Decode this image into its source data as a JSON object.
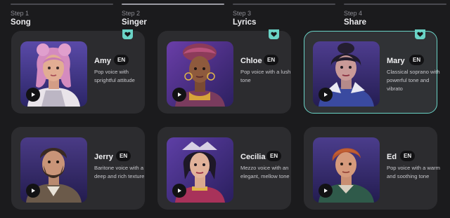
{
  "steps": [
    {
      "number": "Step 1",
      "name": "Song"
    },
    {
      "number": "Step 2",
      "name": "Singer"
    },
    {
      "number": "Step 3",
      "name": "Lyrics"
    },
    {
      "number": "Step 4",
      "name": "Share"
    }
  ],
  "active_step": "Step 2",
  "accent_color": "#6ad3c6",
  "singers": [
    {
      "name": "Amy",
      "lang": "EN",
      "desc": "Pop voice with sprightful attitude",
      "favorite": true,
      "selected": false
    },
    {
      "name": "Chloe",
      "lang": "EN",
      "desc": "Pop voice with a lush tone",
      "favorite": true,
      "selected": false
    },
    {
      "name": "Mary",
      "lang": "EN",
      "desc": "Classical soprano with powerful tone and vibrato",
      "favorite": true,
      "selected": true
    },
    {
      "name": "Jerry",
      "lang": "EN",
      "desc": "Baritone voice with a deep and rich texture",
      "favorite": false,
      "selected": false
    },
    {
      "name": "Cecilia",
      "lang": "EN",
      "desc": "Mezzo voice with an elegant, mellow tone",
      "favorite": false,
      "selected": false
    },
    {
      "name": "Ed",
      "lang": "EN",
      "desc": "Pop voice with a warm and soothing tone",
      "favorite": false,
      "selected": false
    }
  ],
  "icons": {
    "play": "play-icon",
    "favorite": "heart-icon"
  }
}
